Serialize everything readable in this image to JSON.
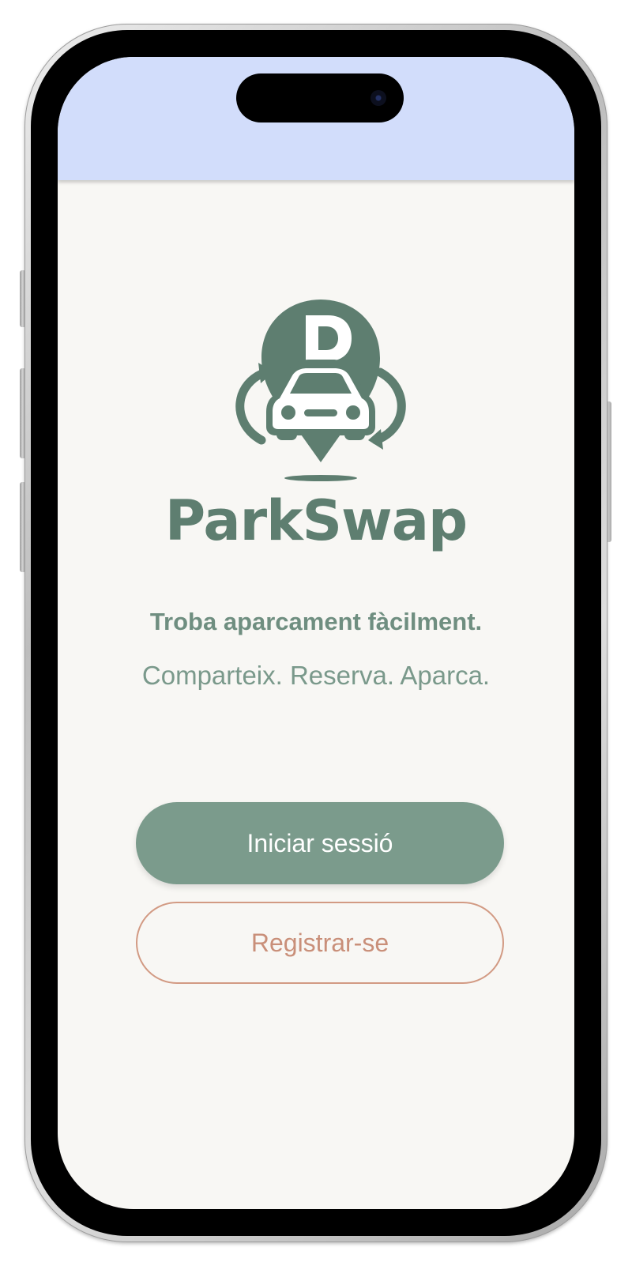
{
  "app": {
    "name": "ParkSwap",
    "tagline": "Troba aparcament fàcilment.",
    "subtagline": "Comparteix. Reserva. Aparca."
  },
  "auth": {
    "login_label": "Iniciar sessió",
    "register_label": "Registrar-se"
  },
  "icons": {
    "logo": "parking-pin-car-swap-icon",
    "camera": "front-camera-icon"
  },
  "colors": {
    "brand_green": "#5e7e70",
    "button_green": "#7b9b8c",
    "accent_terracotta": "#c98f79",
    "status_bar": "#d2ddfb",
    "background": "#f8f7f4"
  }
}
